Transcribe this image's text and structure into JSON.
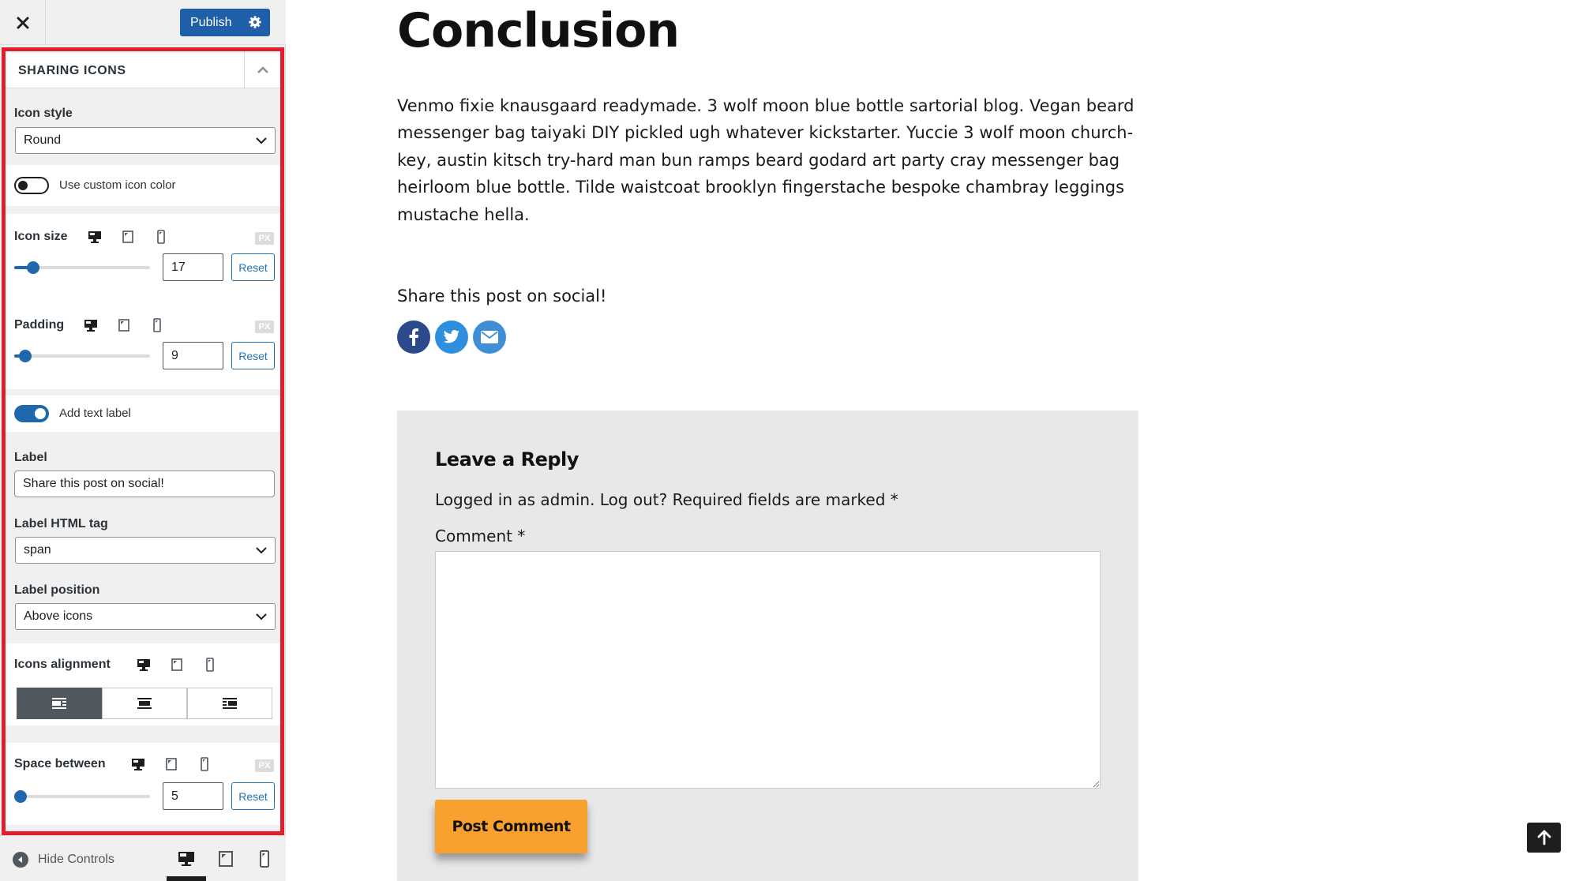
{
  "customizer": {
    "close_label": "Close",
    "publish_label": "Publish",
    "section_title": "SHARING ICONS",
    "icon_style": {
      "label": "Icon style",
      "value": "Round"
    },
    "custom_color": {
      "label": "Use custom icon color",
      "enabled": false
    },
    "icon_size": {
      "label": "Icon size",
      "value": "17",
      "unit": "PX",
      "reset_label": "Reset",
      "slider_fraction": 0.14
    },
    "padding": {
      "label": "Padding",
      "value": "9",
      "unit": "PX",
      "reset_label": "Reset",
      "slider_fraction": 0.08
    },
    "text_label_toggle": {
      "label": "Add text label",
      "enabled": true
    },
    "label_field": {
      "label": "Label",
      "value": "Share this post on social!"
    },
    "label_tag": {
      "label": "Label HTML tag",
      "value": "span"
    },
    "label_position": {
      "label": "Label position",
      "value": "Above icons"
    },
    "icons_alignment": {
      "label": "Icons alignment",
      "options": [
        "left",
        "center",
        "right"
      ],
      "selected": "left"
    },
    "space_between": {
      "label": "Space between",
      "value": "5",
      "unit": "PX",
      "reset_label": "Reset",
      "slider_fraction": 0.04
    },
    "footer": {
      "hide_controls_label": "Hide Controls",
      "active_device": "desktop"
    }
  },
  "article": {
    "title": "Conclusion",
    "paragraph": "Venmo fixie knausgaard readymade. 3 wolf moon blue bottle sartorial blog. Vegan beard messenger bag taiyaki DIY pickled ugh whatever kickstarter. Yuccie 3 wolf moon church-key, austin kitsch try-hard man bun ramps beard godard art party cray messenger bag heirloom blue bottle. Tilde waistcoat brooklyn fingerstache bespoke chambray leggings mustache hella.",
    "share_label": "Share this post on social!",
    "share_icons": [
      {
        "name": "facebook-icon",
        "color": "#2b4a8b"
      },
      {
        "name": "twitter-icon",
        "color": "#2d8fde"
      },
      {
        "name": "email-icon",
        "color": "#3f8fd6"
      }
    ]
  },
  "comments": {
    "title": "Leave a Reply",
    "logged_in_text": "Logged in as admin. Log out? Required fields are marked *",
    "comment_label": "Comment *",
    "comment_value": "",
    "submit_label": "Post Comment"
  },
  "colors": {
    "accent": "#2271b1",
    "highlight_border": "#e11d2e",
    "submit_button": "#f8a12f"
  }
}
